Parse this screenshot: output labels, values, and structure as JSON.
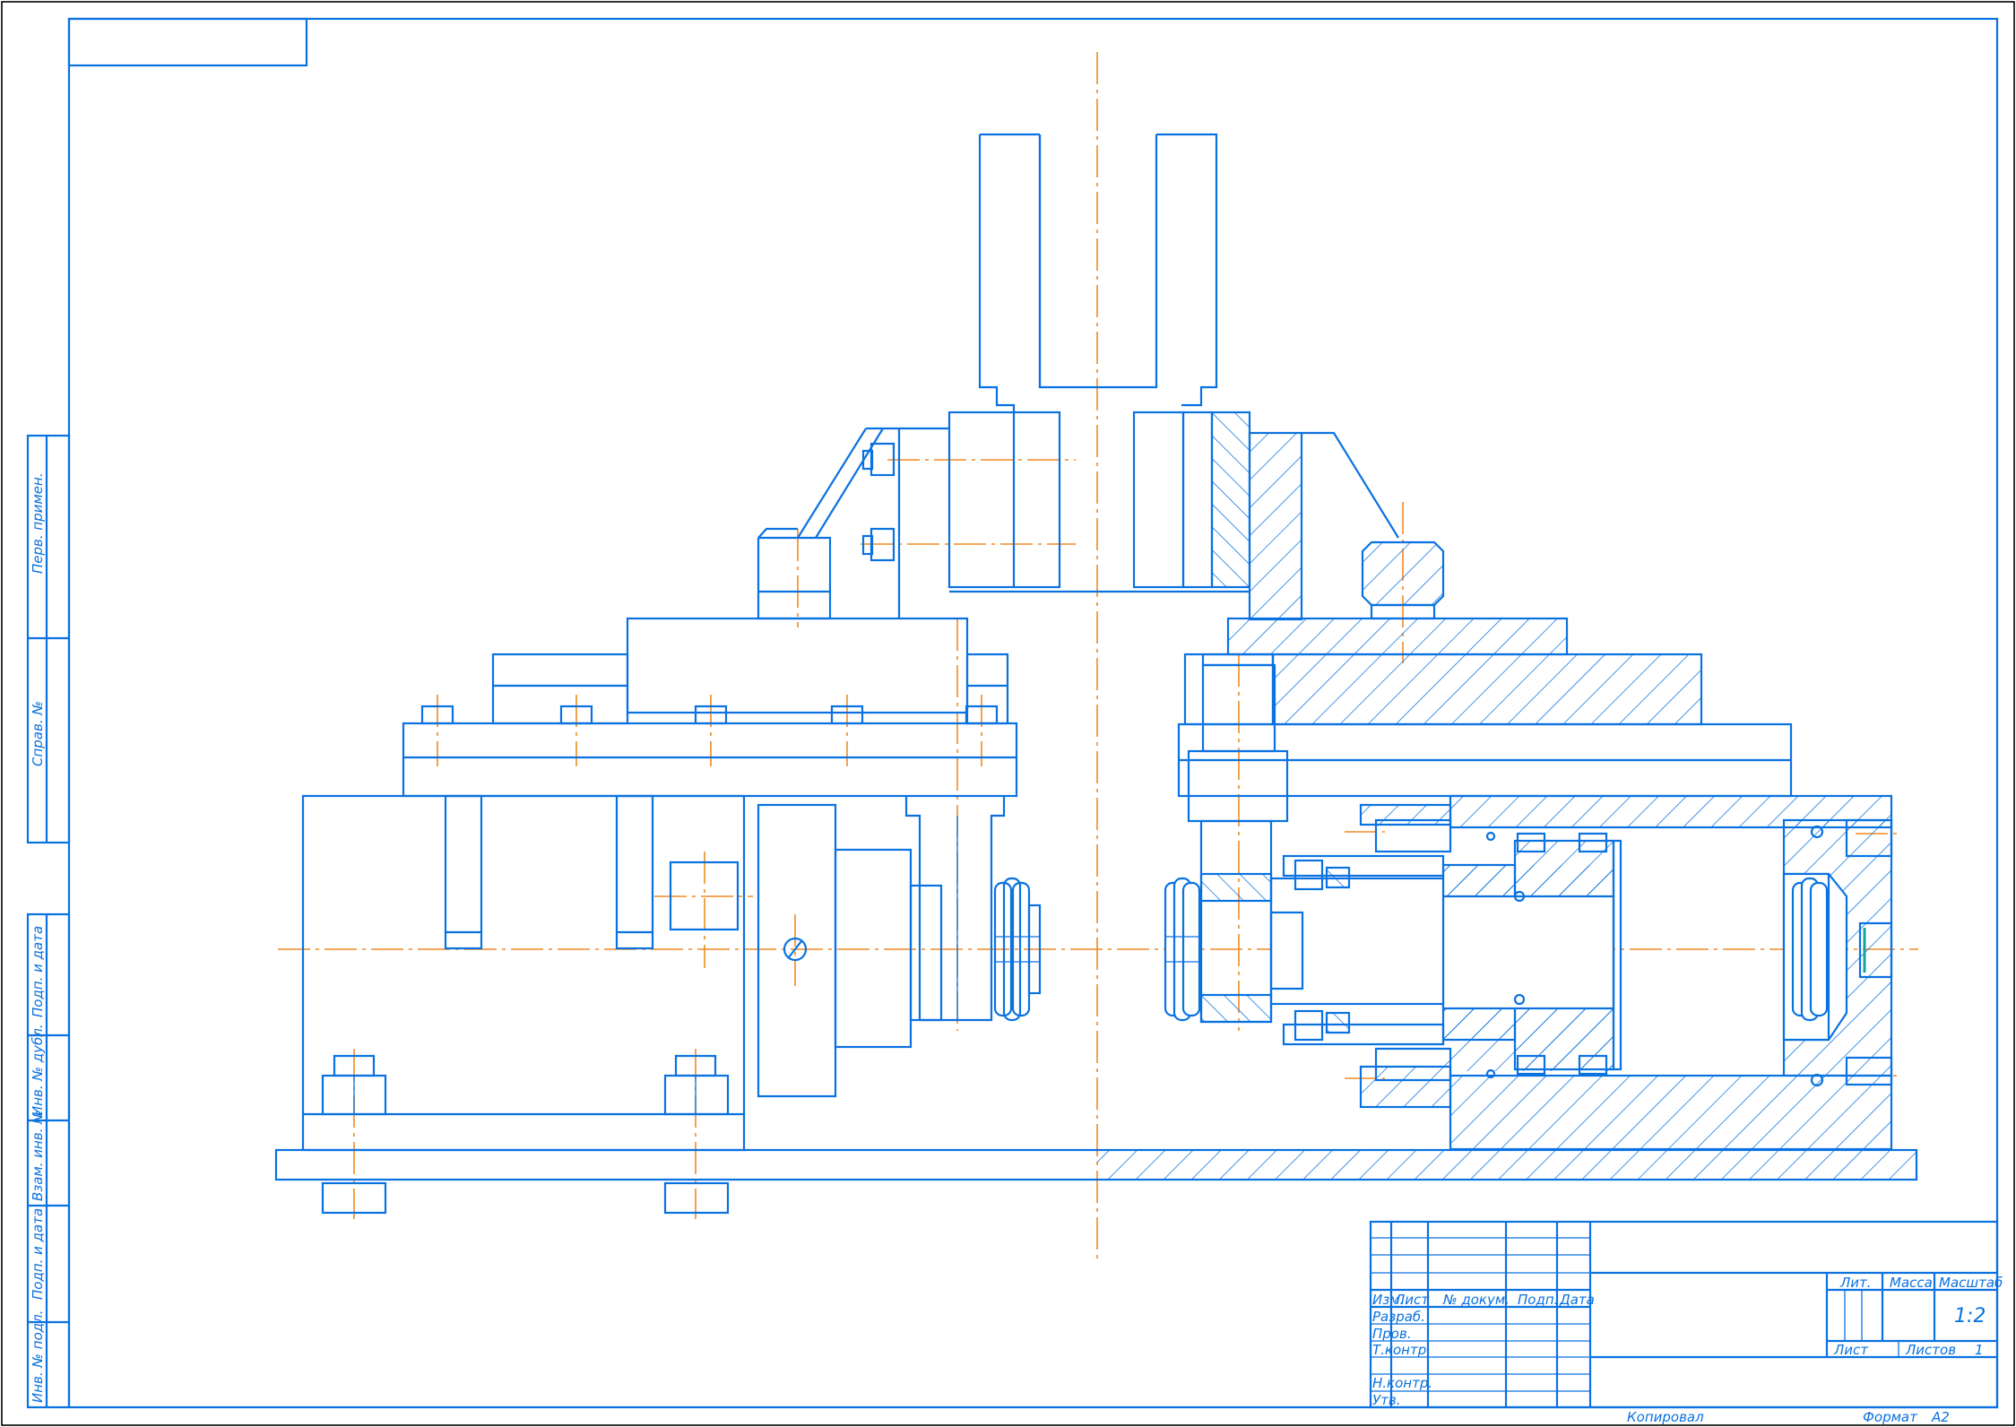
{
  "drawing": {
    "product_name": "Копировал",
    "format_label": "Формат",
    "format_value": "А2",
    "scale": "1:2",
    "sheet_number": "1"
  },
  "side_stamp": {
    "labels": [
      "Перв. примен.",
      "Справ. №",
      "Подп. и дата",
      "Инв. № дубл.",
      "Взам. инв. №",
      "Подп. и дата",
      "Инв. № подл."
    ]
  },
  "title_block": {
    "headers": {
      "izm": "Изм.",
      "list": "Лист",
      "doc": "№ докум.",
      "podp": "Подп.",
      "data": "Дата"
    },
    "roles": [
      "Разраб.",
      "Пров.",
      "Т.контр.",
      "",
      "Н.контр.",
      "Утв."
    ],
    "lit": "Лит.",
    "massa": "Масса",
    "masshtab": "Масштаб",
    "list_label": "Лист",
    "listov_label": "Листов"
  },
  "colors": {
    "line": "#0a72e0",
    "axis": "#f08a24",
    "border": "#000000"
  }
}
